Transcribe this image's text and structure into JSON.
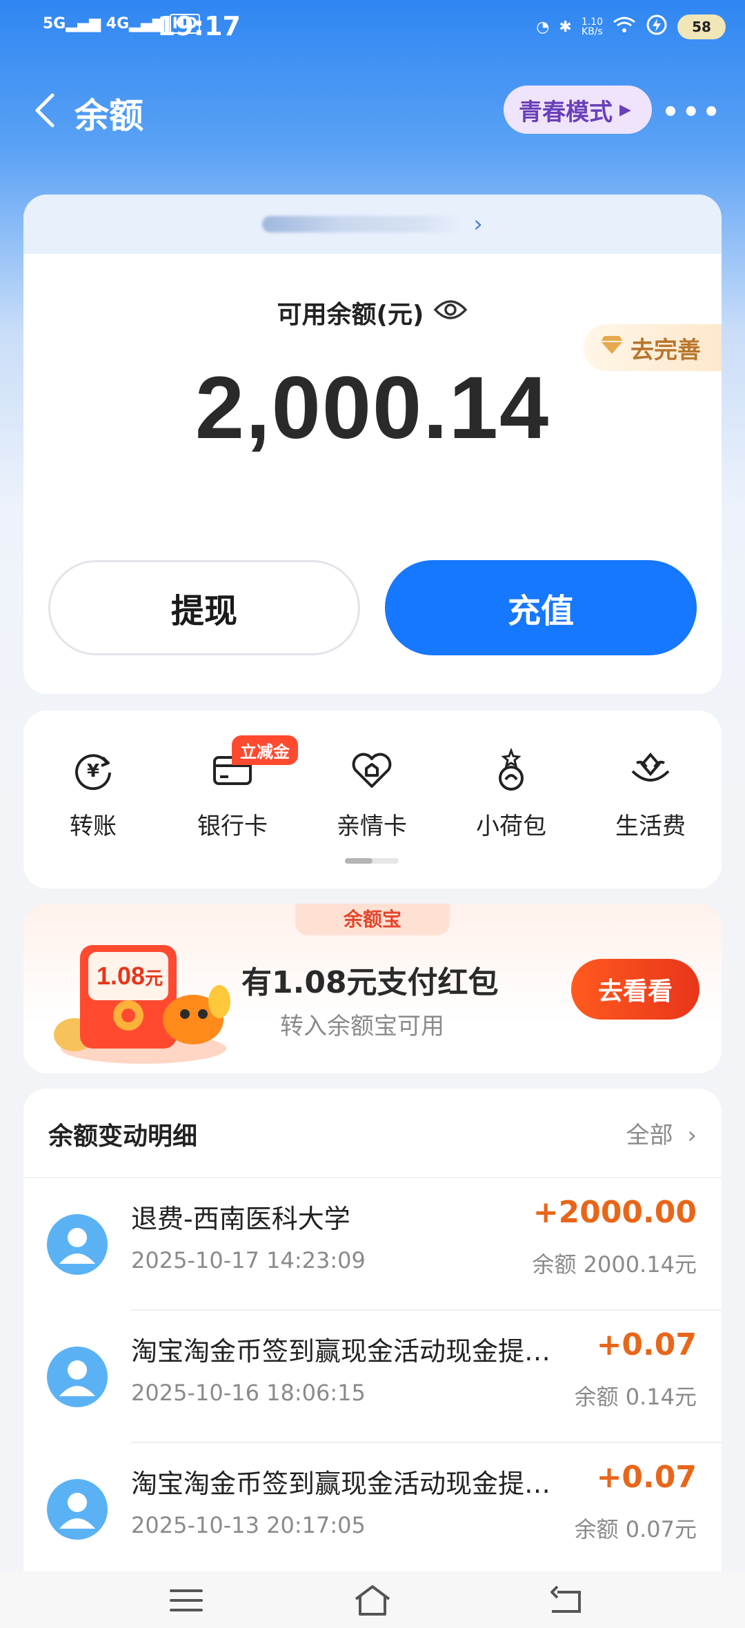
{
  "status_bar": {
    "signal1": "5G",
    "signal2": "4G",
    "hd": "HD",
    "time": "19:17",
    "net_speed": "1.10\nKB/s",
    "battery": "58"
  },
  "nav": {
    "title": "余额",
    "youth_mode": "青春模式"
  },
  "balance_card": {
    "label": "可用余额(元)",
    "amount": "2,000.14",
    "perfect_label": "去完善",
    "withdraw_label": "提现",
    "topup_label": "充值"
  },
  "services": {
    "items": [
      {
        "label": "转账",
        "icon": "transfer-icon"
      },
      {
        "label": "银行卡",
        "icon": "bank-card-icon"
      },
      {
        "label": "亲情卡",
        "icon": "family-card-icon"
      },
      {
        "label": "小荷包",
        "icon": "small-wallet-icon"
      },
      {
        "label": "生活费",
        "icon": "living-expense-icon"
      }
    ],
    "bank_tag": "立减金"
  },
  "promo": {
    "tab": "余额宝",
    "redpack_amount": "1.08",
    "redpack_unit": "元",
    "title": "有1.08元支付红包",
    "subtitle": "转入余额宝可用",
    "button": "去看看"
  },
  "details": {
    "title": "余额变动明细",
    "all_label": "全部",
    "rows": [
      {
        "name": "退费-西南医科大学",
        "date": "2025-10-17 14:23:09",
        "amount": "+2000.00",
        "balance": "余额 2000.14元"
      },
      {
        "name": "淘宝淘金币签到赢现金活动现金提…",
        "date": "2025-10-16 18:06:15",
        "amount": "+0.07",
        "balance": "余额 0.14元"
      },
      {
        "name": "淘宝淘金币签到赢现金活动现金提…",
        "date": "2025-10-13 20:17:05",
        "amount": "+0.07",
        "balance": "余额 0.07元"
      }
    ]
  },
  "colors": {
    "primary": "#1677ff",
    "amount_orange": "#e8661a",
    "promo_red": "#e8351a",
    "avatar_blue": "#5ab2f5"
  }
}
